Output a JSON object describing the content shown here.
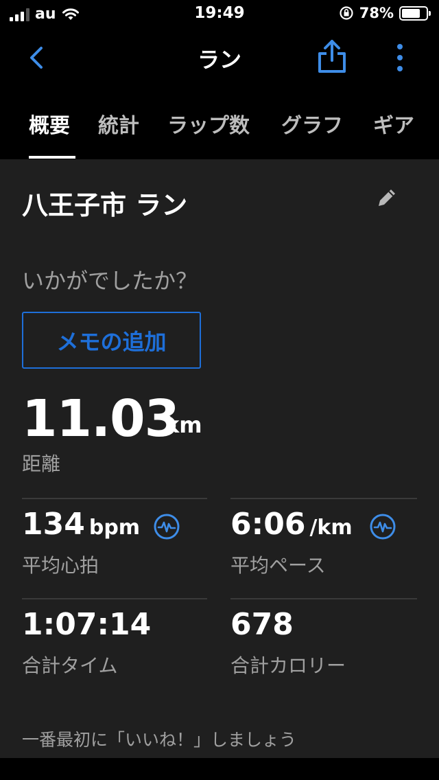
{
  "status_bar": {
    "carrier": "au",
    "time": "19:49",
    "battery_percent": "78%",
    "battery_level": 0.78
  },
  "nav": {
    "title": "ラン",
    "back_icon": "chevron-left-icon",
    "share_icon": "share-icon",
    "more_icon": "more-vertical-icon"
  },
  "tabs": [
    "概要",
    "統計",
    "ラップ数",
    "グラフ",
    "ギア"
  ],
  "activity": {
    "name": "ラン",
    "location": "八王子市",
    "full_name": "八王子市 ラン"
  },
  "question": "いかがでしたか？",
  "memo_button": "メモの追加",
  "distance": {
    "value": "11.03",
    "unit": "km",
    "label": "距離"
  },
  "stats": [
    {
      "value": "134",
      "unit": "bpm",
      "label": "平均心拍",
      "icon": "heart-rate-icon"
    },
    {
      "value": "6:06",
      "unit": "/km",
      "label": "平均ペース",
      "icon": "heart-rate-icon"
    },
    {
      "value": "1:07:14",
      "unit": "",
      "label": "合計タイム"
    },
    {
      "value": "678",
      "unit": "",
      "label": "合計カロリー"
    }
  ],
  "like_prompt": "一番最初に「いいね！」しましょう",
  "colors": {
    "accent": "#1e6fd9",
    "icon_blue": "#3e8de8",
    "background": "#000000",
    "card": "#1f1f1f"
  }
}
